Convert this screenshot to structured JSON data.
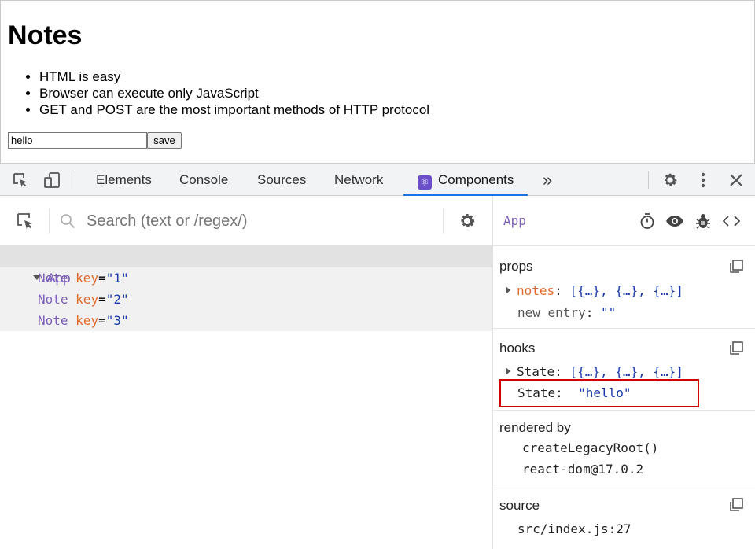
{
  "page": {
    "title": "Notes",
    "notes": [
      "HTML is easy",
      "Browser can execute only JavaScript",
      "GET and POST are the most important methods of HTTP protocol"
    ],
    "input_value": "hello",
    "save_label": "save"
  },
  "devtools": {
    "tabs": [
      {
        "label": "Elements"
      },
      {
        "label": "Console"
      },
      {
        "label": "Sources"
      },
      {
        "label": "Network"
      },
      {
        "label": "Components"
      }
    ],
    "more_label": "»",
    "active_tab": "Components",
    "accent": "#1a73e8"
  },
  "tree": {
    "search_placeholder": "Search (text or /regex/)",
    "root": "App",
    "children": [
      {
        "name": "Note",
        "key_label": "key",
        "key_value": "\"1\""
      },
      {
        "name": "Note",
        "key_label": "key",
        "key_value": "\"2\""
      },
      {
        "name": "Note",
        "key_label": "key",
        "key_value": "\"3\""
      }
    ]
  },
  "inspector": {
    "component": "App",
    "props": {
      "title": "props",
      "notes_key": "notes",
      "notes_value": "[{…}, {…}, {…}]",
      "entry_key": "new entry",
      "entry_value": "\"\""
    },
    "hooks": {
      "title": "hooks",
      "state1_key": "State",
      "state1_value": "[{…}, {…}, {…}]",
      "state2_key": "State",
      "state2_value": "\"hello\""
    },
    "rendered_by": {
      "title": "rendered by",
      "items": [
        "createLegacyRoot()",
        "react-dom@17.0.2"
      ]
    },
    "source": {
      "title": "source",
      "value": "src/index.js:27"
    }
  }
}
